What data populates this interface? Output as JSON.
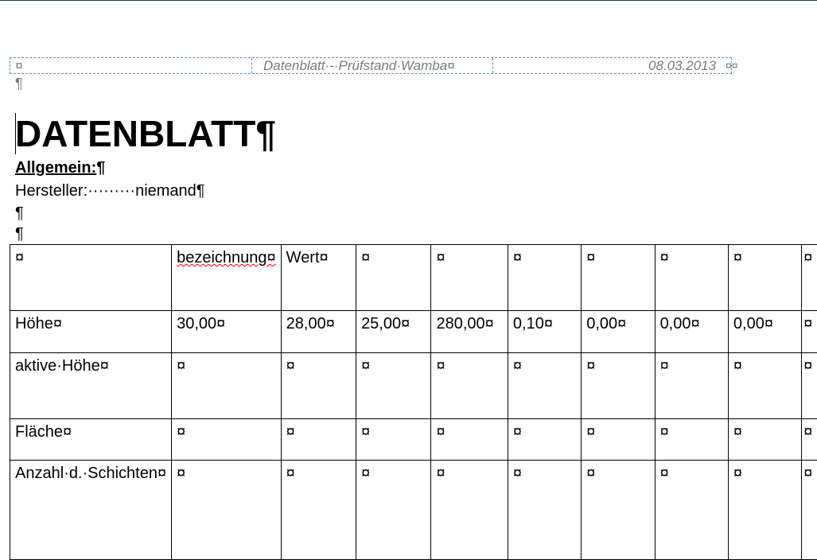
{
  "header": {
    "left_mark": "¤",
    "title": "Datenblatt·-·Prüfstand·Wamba¤",
    "date": "08.03.2013",
    "end_marks": "¤¤",
    "para_mark": "¶"
  },
  "title": "DATENBLATT¶",
  "section": {
    "label": "Allgemein:",
    "mark": "¶"
  },
  "manufacturer": "Hersteller:·········niemand¶",
  "empty_paras": [
    "¶",
    "¶"
  ],
  "table": {
    "rows": [
      [
        "¤",
        "bezeichnung¤",
        "Wert¤",
        "¤",
        "¤",
        "¤",
        "¤",
        "¤",
        "¤",
        "¤"
      ],
      [
        "Höhe¤",
        "30,00¤",
        "28,00¤",
        "25,00¤",
        "280,00¤",
        "0,10¤",
        "0,00¤",
        "0,00¤",
        "0,00¤",
        "¤"
      ],
      [
        "aktive·Höhe¤",
        "¤",
        "¤",
        "¤",
        "¤",
        "¤",
        "¤",
        "¤",
        "¤",
        "¤"
      ],
      [
        "Fläche¤",
        "¤",
        "¤",
        "¤",
        "¤",
        "¤",
        "¤",
        "¤",
        "¤",
        "¤"
      ],
      [
        "Anzahl·d.·Schichten¤",
        "¤",
        "¤",
        "¤",
        "¤",
        "¤",
        "¤",
        "¤",
        "¤",
        "¤"
      ]
    ]
  }
}
